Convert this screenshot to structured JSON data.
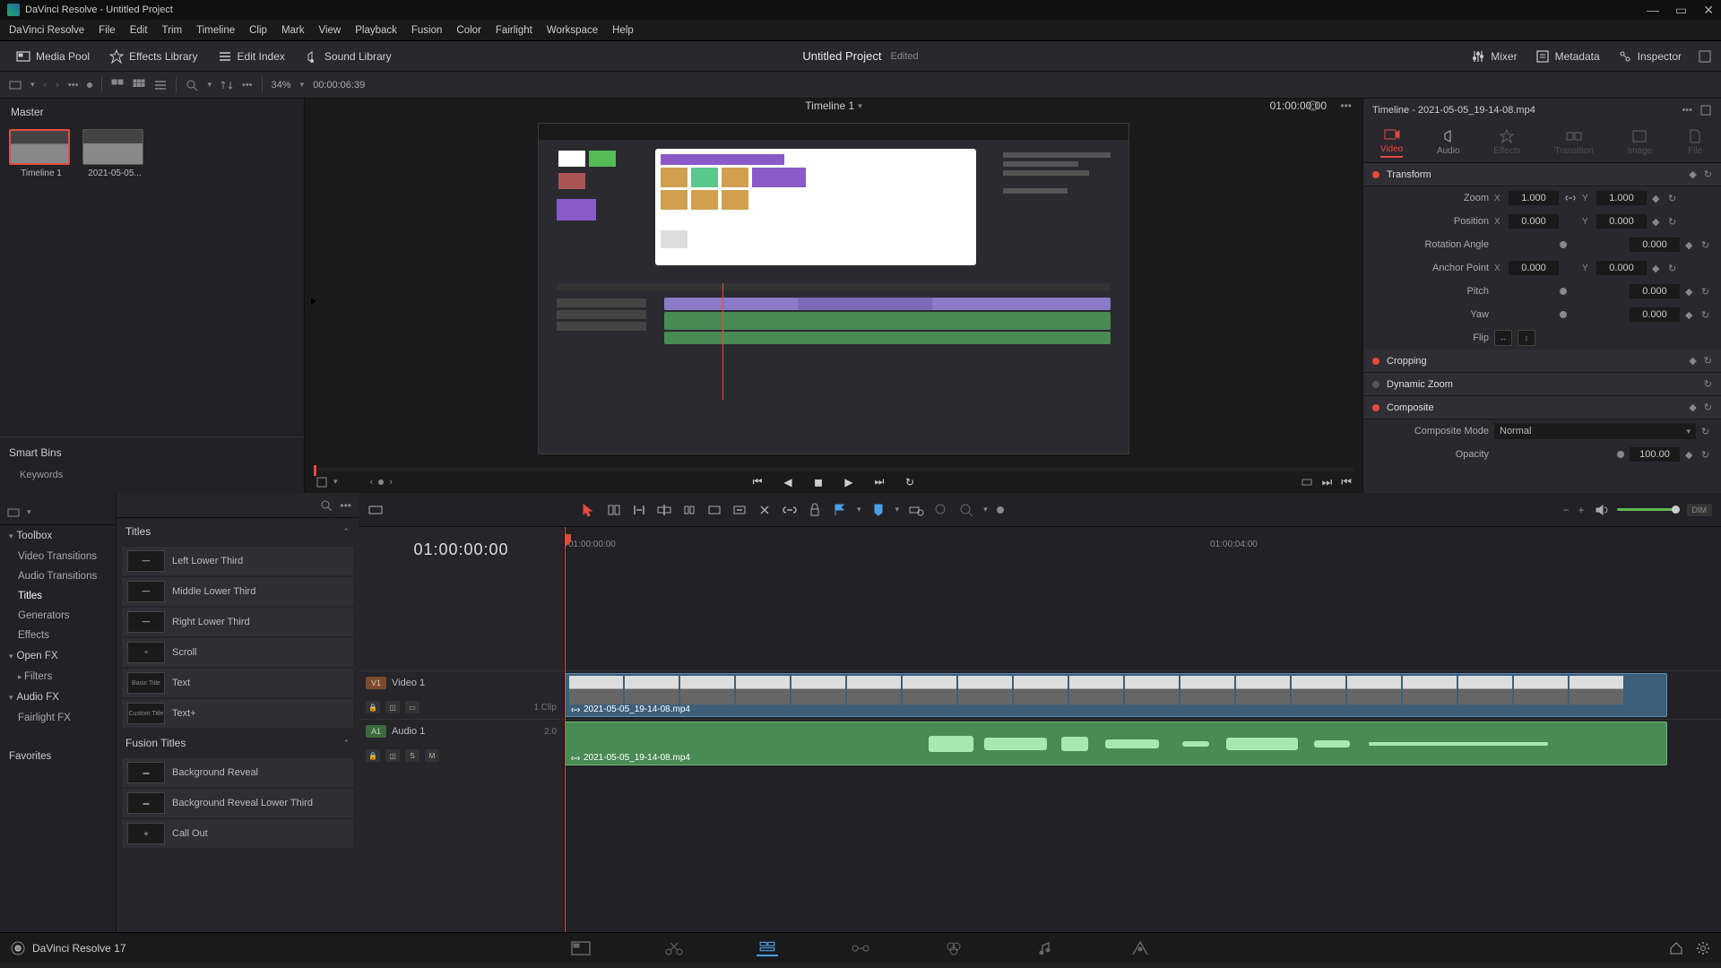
{
  "titlebar": {
    "text": "DaVinci Resolve - Untitled Project"
  },
  "menubar": [
    "DaVinci Resolve",
    "File",
    "Edit",
    "Trim",
    "Timeline",
    "Clip",
    "Mark",
    "View",
    "Playback",
    "Fusion",
    "Color",
    "Fairlight",
    "Workspace",
    "Help"
  ],
  "top_toolbar": {
    "media_pool": "Media Pool",
    "effects_library": "Effects Library",
    "edit_index": "Edit Index",
    "sound_library": "Sound Library",
    "mixer": "Mixer",
    "metadata": "Metadata",
    "inspector": "Inspector"
  },
  "project": {
    "name": "Untitled Project",
    "status": "Edited"
  },
  "sec_bar": {
    "zoom_pct": "34%",
    "tc": "00:00:06:39"
  },
  "media_pool": {
    "master": "Master",
    "smart_bins": "Smart Bins",
    "keywords": "Keywords",
    "items": [
      {
        "label": "Timeline 1"
      },
      {
        "label": "2021-05-05..."
      }
    ]
  },
  "viewer": {
    "title": "Timeline 1",
    "tc": "01:00:00:00",
    "dots": "•••"
  },
  "inspector": {
    "header": "Timeline - 2021-05-05_19-14-08.mp4",
    "tabs": [
      "Video",
      "Audio",
      "Effects",
      "Transition",
      "Image",
      "File"
    ],
    "transform": {
      "title": "Transform",
      "zoom_label": "Zoom",
      "zoom_x": "1.000",
      "zoom_y": "1.000",
      "position_label": "Position",
      "pos_x": "0.000",
      "pos_y": "0.000",
      "rotation_label": "Rotation Angle",
      "rotation": "0.000",
      "anchor_label": "Anchor Point",
      "anchor_x": "0.000",
      "anchor_y": "0.000",
      "pitch_label": "Pitch",
      "pitch": "0.000",
      "yaw_label": "Yaw",
      "yaw": "0.000",
      "flip_label": "Flip"
    },
    "cropping": "Cropping",
    "dynamic_zoom": "Dynamic Zoom",
    "composite": "Composite",
    "composite_mode_label": "Composite Mode",
    "composite_mode": "Normal",
    "opacity_label": "Opacity",
    "opacity": "100.00"
  },
  "fx_nav": {
    "toolbox": "Toolbox",
    "items": [
      "Video Transitions",
      "Audio Transitions",
      "Titles",
      "Generators",
      "Effects"
    ],
    "open_fx": "Open FX",
    "filters": "Filters",
    "audio_fx": "Audio FX",
    "fairlight_fx": "Fairlight FX",
    "favorites": "Favorites"
  },
  "titles": {
    "header": "Titles",
    "items": [
      "Left Lower Third",
      "Middle Lower Third",
      "Right Lower Third",
      "Scroll",
      "Text",
      "Text+"
    ],
    "previews": [
      "",
      "",
      "",
      "",
      "Basic Title",
      "Custom Title"
    ],
    "fusion_header": "Fusion Titles",
    "fusion_items": [
      "Background Reveal",
      "Background Reveal Lower Third",
      "Call Out"
    ]
  },
  "timeline": {
    "big_tc": "01:00:00:00",
    "ruler": [
      {
        "pos": 0,
        "label": "01:00:00:00"
      },
      {
        "pos": 540,
        "label": "01:00:04:00"
      }
    ],
    "video_track": {
      "badge": "V1",
      "label": "Video 1",
      "info": "1 Clip"
    },
    "audio_track": {
      "badge": "A1",
      "label": "Audio 1",
      "info": "2.0"
    },
    "clip_name": "2021-05-05_19-14-08.mp4",
    "dim": "DIM",
    "s": "S",
    "m": "M"
  },
  "footer": {
    "app": "DaVinci Resolve 17"
  }
}
